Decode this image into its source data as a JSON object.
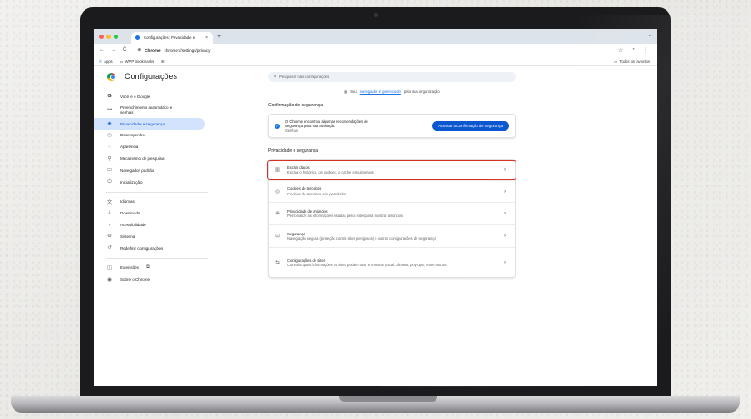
{
  "window": {
    "tab_title": "Configurações: Privacidade e",
    "tab_close": "×",
    "new_tab": "+",
    "dot_colors": [
      "#ff5f57",
      "#febc2e",
      "#28c840"
    ]
  },
  "toolbar": {
    "back": "←",
    "forward": "→",
    "reload": "C",
    "chrome_chip": "Chrome",
    "url": "chrome://settings/privacy",
    "right_icons": [
      "☆",
      "◔",
      "⋮"
    ]
  },
  "bookmarks": {
    "apps": "Apps",
    "wpp": "WPP Bookmarks",
    "all_favorites": "Todos os favoritos"
  },
  "header": {
    "title": "Configurações",
    "search_placeholder": "Pesquisar nas configurações"
  },
  "sidebar": {
    "items": [
      {
        "label": "Você e o Google",
        "icon": "G"
      },
      {
        "label": "Preenchimento automático e senhas",
        "icon": "⊶"
      },
      {
        "label": "Privacidade e segurança",
        "icon": "◈"
      },
      {
        "label": "Desempenho",
        "icon": "◷"
      },
      {
        "label": "Aparência",
        "icon": "◌"
      },
      {
        "label": "Mecanismo de pesquisa",
        "icon": "⚲"
      },
      {
        "label": "Navegador padrão",
        "icon": "▭"
      },
      {
        "label": "Inicialização",
        "icon": "⏻"
      },
      {
        "label": "Idiomas",
        "icon": "文"
      },
      {
        "label": "Downloads",
        "icon": "⤓"
      },
      {
        "label": "Acessibilidade",
        "icon": "♀"
      },
      {
        "label": "Sistema",
        "icon": "⚙"
      },
      {
        "label": "Redefinir configurações",
        "icon": "↺"
      },
      {
        "label": "Extensões",
        "icon": "⧉"
      },
      {
        "label": "Sobre o Chrome",
        "icon": "◉"
      }
    ]
  },
  "main": {
    "managed_prefix": "Seu",
    "managed_link": "navegador é gerenciado",
    "managed_suffix": "pela sua organização",
    "safety_title": "Confirmação de segurança",
    "safety_line1": "O Chrome encontrou algumas recomendações de",
    "safety_line2": "segurança para sua avaliação",
    "safety_sub": "Senhas",
    "safety_button": "Acessar a Confirmação de Segurança",
    "privacy_title": "Privacidade e segurança",
    "rows": [
      {
        "title": "Excluir dados",
        "subtitle": "Exclua o histórico, os cookies, o cache e muito mais",
        "icon": "🗑"
      },
      {
        "title": "Cookies de terceiros",
        "subtitle": "Cookies de terceiros são permitidos",
        "icon": "◎"
      },
      {
        "title": "Privacidade de anúncios",
        "subtitle": "Personalize as informações usadas pelos sites para mostrar anúncios",
        "icon": "⊕"
      },
      {
        "title": "Segurança",
        "subtitle": "Navegação segura (proteção contra sites perigosos) e outras configurações de segurança",
        "icon": "⊡"
      },
      {
        "title": "Configurações de sites",
        "subtitle": "Controla quais informações os sites podem usar e mostrar (local, câmera, pop-ups, entre outros)",
        "icon": "⇆"
      }
    ],
    "chevron": "›"
  },
  "colors": {
    "accent": "#0b57d0",
    "active_bg": "#d3e3fd",
    "highlight": "#d93025"
  }
}
